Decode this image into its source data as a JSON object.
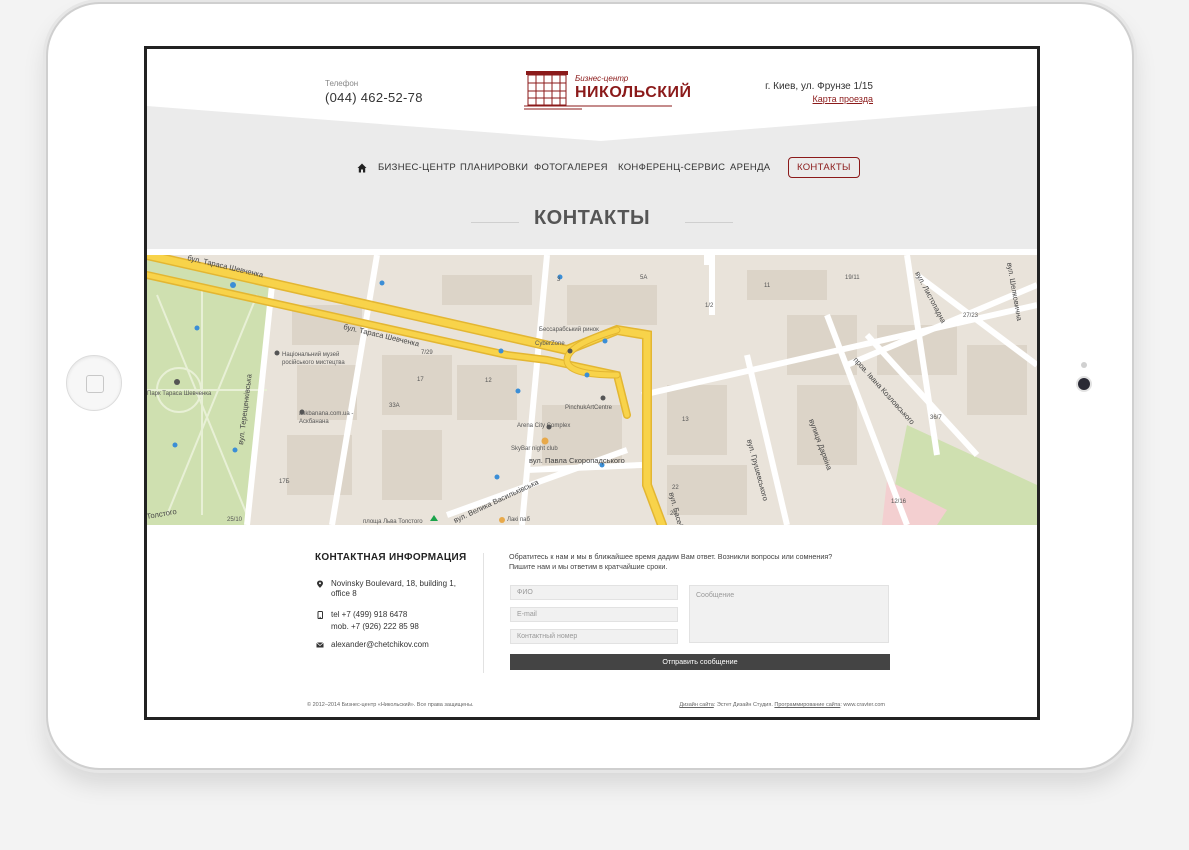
{
  "header": {
    "phone_caption": "Телефон",
    "phone_number": "(044) 462-52-78",
    "logo_caption": "Бизнес-центр",
    "logo_name": "НИКОЛЬСКИЙ",
    "address": "г. Киев, ул. Фрунзе 1/15",
    "route_link": "Карта проезда"
  },
  "nav": {
    "home_icon": "home-icon",
    "items": [
      {
        "label": "БИЗНЕС-ЦЕНТР"
      },
      {
        "label": "ПЛАНИРОВКИ"
      },
      {
        "label": "ФОТОГАЛЕРЕЯ"
      },
      {
        "label": "КОНФЕРЕНЦ-СЕРВИС"
      },
      {
        "label": "АРЕНДА"
      },
      {
        "label": "КОНТАКТЫ",
        "active": true
      }
    ]
  },
  "page_title": "КОНТАКТЫ",
  "map": {
    "streets": [
      "бул. Тараса Шевченка",
      "вул. Павла Скоропадського",
      "вул. Басейна",
      "вул. Терещенківська",
      "вул. Велика Васильківська",
      "Толстого",
      "вул. Шелковична",
      "пров. Івана Козловського",
      "вулиця Дарвіна",
      "вул. Грушевського",
      "вул. Листопадна"
    ],
    "poi": [
      "Бессарабський ринок",
      "CyberZone",
      "PinchukArtCentre",
      "Arena City Complex",
      "SkyBar night club",
      "Національний музей російського мистецтва",
      "Парк Тараса Шевченка",
      "askbanana.com.ua - Аскбанана",
      "Лакі паб",
      "площа Льва Толстого"
    ],
    "house_numbers": [
      "3",
      "5А",
      "1/2",
      "19/11",
      "11",
      "7/29",
      "17",
      "33А",
      "12",
      "13",
      "27/23",
      "36/7",
      "22",
      "20",
      "12/16",
      "17Б",
      "25/10"
    ],
    "colors": {
      "road": "#f8d34a",
      "road_edge": "#e3b632",
      "park": "#cfe0b0",
      "block": "#dcd4c8",
      "ground": "#e9e3da"
    }
  },
  "contacts": {
    "title": "КОНТАКТНАЯ ИНФОРМАЦИЯ",
    "address_line1": "Novinsky Boulevard, 18, building 1,",
    "address_line2": "office 8",
    "tel": "tel  +7 (499) 918 6478",
    "mob": "mob. +7 (926) 222 85 98",
    "email": "alexander@chetchikov.com",
    "icons": {
      "address": "map-pin-icon",
      "phone": "phone-icon",
      "email": "envelope-icon"
    }
  },
  "form": {
    "intro_line1": "Обратитесь к нам и мы в ближайшее время дадим Вам ответ. Возникли вопросы или сомнения?",
    "intro_line2": "Пишите нам и мы ответим в кратчайшие сроки.",
    "name_placeholder": "ФИО",
    "email_placeholder": "E-mail",
    "phone_placeholder": "Контактный номер",
    "message_placeholder": "Сообщение",
    "submit_label": "Отправить сообщение"
  },
  "footer": {
    "copyright": "© 2012–2014 Бизнес-центр «Никольский». Все права защищены.",
    "design_link": "Дизайн сайта",
    "design_by": ": Эстет Дизайн Студия.",
    "dev_link": "Программирование сайта",
    "dev_by": ": www.cravter.com"
  },
  "accent_color": "#8b1a1a"
}
